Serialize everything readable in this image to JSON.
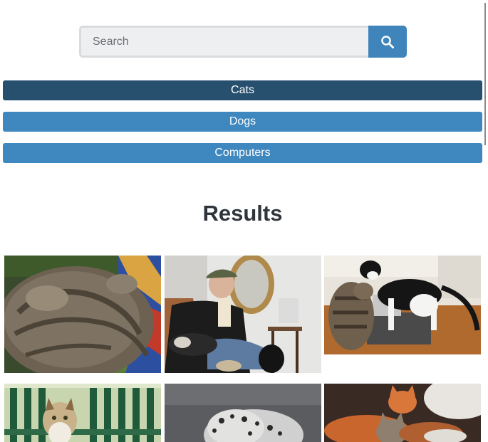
{
  "search": {
    "placeholder": "Search",
    "value": "",
    "button_icon": "search-icon",
    "button_color": "#3f85bb"
  },
  "categories": [
    {
      "label": "Cats",
      "active": true
    },
    {
      "label": "Dogs",
      "active": false
    },
    {
      "label": "Computers",
      "active": false
    }
  ],
  "colors": {
    "active_category": "#27506f",
    "category": "#3f87bf",
    "heading": "#2f353a"
  },
  "results": {
    "title": "Results"
  }
}
